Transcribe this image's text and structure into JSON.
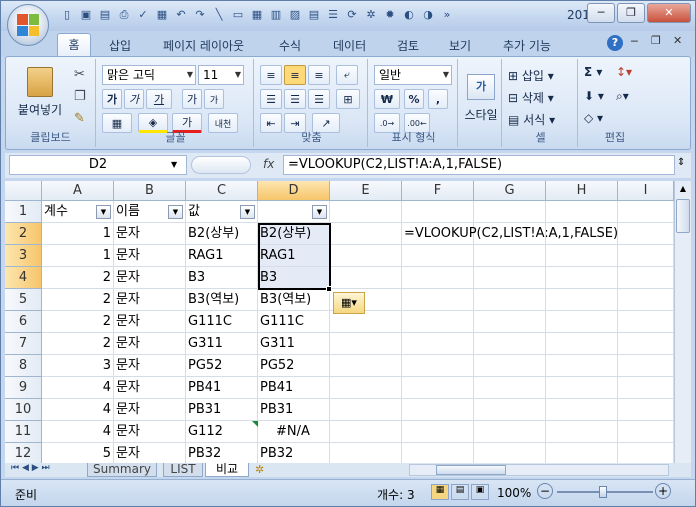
{
  "title": {
    "document": "201...",
    "qat_icons": [
      "new-icon",
      "save-icon",
      "print-preview-icon",
      "print-icon",
      "spell-check-icon",
      "paste-icon",
      "undo-icon",
      "redo-icon",
      "line-icon",
      "shapes-icon",
      "misc-icon"
    ]
  },
  "tabs": [
    "홈",
    "삽입",
    "페이지 레이아웃",
    "수식",
    "데이터",
    "검토",
    "보기",
    "추가 기능"
  ],
  "ribbon": {
    "clipboard": {
      "paste": "붙여넣기",
      "label": "클립보드"
    },
    "font": {
      "name": "맑은 고딕",
      "size": "11",
      "bold": "가",
      "italic": "가",
      "underline": "가",
      "grow": "가",
      "shrink": "가",
      "color_a": "가",
      "phonetic": "내천",
      "label": "글꼴"
    },
    "alignment": {
      "label": "맞춤"
    },
    "number": {
      "format": "일반",
      "currency": "₩",
      "percent": "%",
      "comma": ",",
      "label": "표시 형식"
    },
    "styles": {
      "style": "스타일"
    },
    "cells": {
      "insert": "삽입",
      "delete": "삭제",
      "format": "서식",
      "label": "셀"
    },
    "editing": {
      "sum": "Σ",
      "label": "편집"
    }
  },
  "formula_bar": {
    "name_box": "D2",
    "fx": "fx",
    "formula": "=VLOOKUP(C2,LIST!A:A,1,FALSE)"
  },
  "columns": [
    "A",
    "B",
    "C",
    "D",
    "E",
    "F",
    "G",
    "H",
    "I"
  ],
  "rows": [
    {
      "n": "1",
      "a": "계수",
      "b": "이름",
      "c": "값",
      "d": "",
      "f": ""
    },
    {
      "n": "2",
      "a": "1",
      "b": "문자",
      "c": "B2(상부)",
      "d": "B2(상부)",
      "f": "=VLOOKUP(C2,LIST!A:A,1,FALSE)"
    },
    {
      "n": "3",
      "a": "1",
      "b": "문자",
      "c": "RAG1",
      "d": "RAG1",
      "f": ""
    },
    {
      "n": "4",
      "a": "2",
      "b": "문자",
      "c": "B3",
      "d": "B3",
      "f": ""
    },
    {
      "n": "5",
      "a": "2",
      "b": "문자",
      "c": "B3(역보)",
      "d": "B3(역보)",
      "f": ""
    },
    {
      "n": "6",
      "a": "2",
      "b": "문자",
      "c": "G111C",
      "d": "G111C",
      "f": ""
    },
    {
      "n": "7",
      "a": "2",
      "b": "문자",
      "c": "G311",
      "d": "G311",
      "f": ""
    },
    {
      "n": "8",
      "a": "3",
      "b": "문자",
      "c": "PG52",
      "d": "PG52",
      "f": ""
    },
    {
      "n": "9",
      "a": "4",
      "b": "문자",
      "c": "PB41",
      "d": "PB41",
      "f": ""
    },
    {
      "n": "10",
      "a": "4",
      "b": "문자",
      "c": "PB31",
      "d": "PB31",
      "f": ""
    },
    {
      "n": "11",
      "a": "4",
      "b": "문자",
      "c": "G112",
      "d": "#N/A",
      "f": ""
    },
    {
      "n": "12",
      "a": "5",
      "b": "문자",
      "c": "PB32",
      "d": "PB32",
      "f": ""
    }
  ],
  "sheets": [
    "Summary",
    "LIST",
    "비교"
  ],
  "active_sheet": "비교",
  "status": {
    "ready": "준비",
    "count": "개수: 3",
    "zoom": "100%",
    "zoom_minus": "−",
    "zoom_plus": "+"
  }
}
